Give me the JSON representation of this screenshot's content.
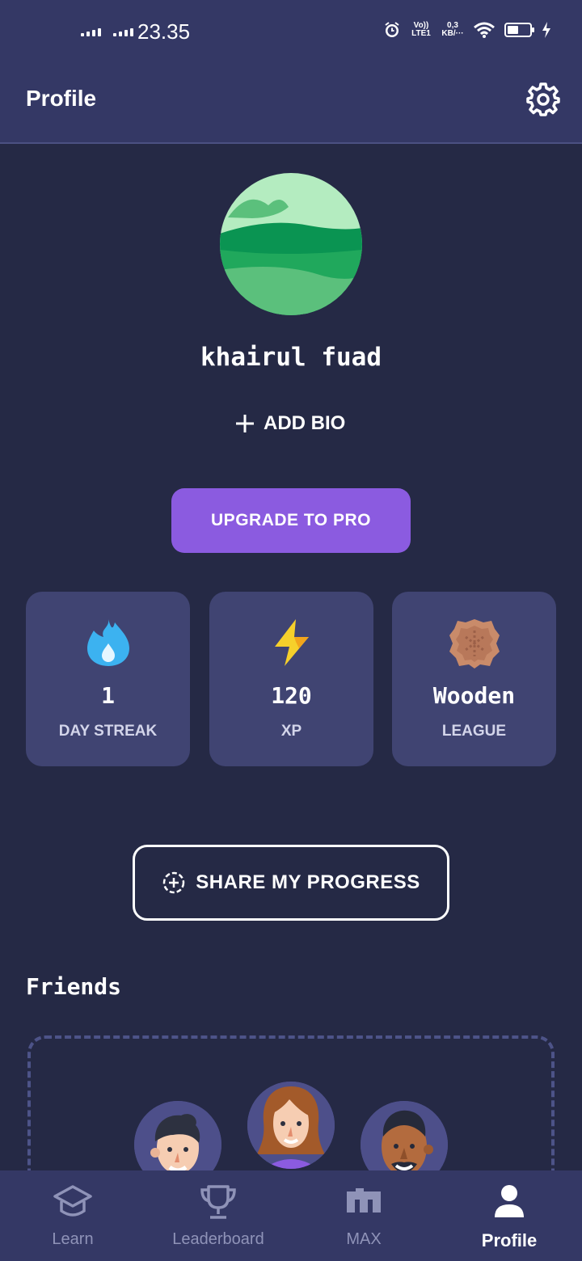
{
  "status_bar": {
    "time": "23.35",
    "network_type": "Vo)) LTE1",
    "data_speed": "0,3 KB/···"
  },
  "header": {
    "title": "Profile"
  },
  "profile": {
    "name": "khairul fuad",
    "add_bio_label": "ADD BIO",
    "upgrade_label": "UPGRADE TO PRO"
  },
  "stats": [
    {
      "icon": "water-drop-icon",
      "value": "1",
      "label": "DAY STREAK"
    },
    {
      "icon": "lightning-icon",
      "value": "120",
      "label": "XP"
    },
    {
      "icon": "wooden-league-badge-icon",
      "value": "Wooden",
      "label": "LEAGUE"
    }
  ],
  "share_label": "SHARE MY PROGRESS",
  "friends": {
    "title": "Friends"
  },
  "nav": [
    {
      "label": "Learn",
      "icon": "graduation-cap-icon"
    },
    {
      "label": "Leaderboard",
      "icon": "trophy-icon"
    },
    {
      "label": "MAX",
      "icon": "max-logo-icon"
    },
    {
      "label": "Profile",
      "icon": "person-icon",
      "active": true
    }
  ],
  "colors": {
    "background": "#252945",
    "header": "#343865",
    "card": "#404472",
    "accent": "#8b5be0"
  }
}
